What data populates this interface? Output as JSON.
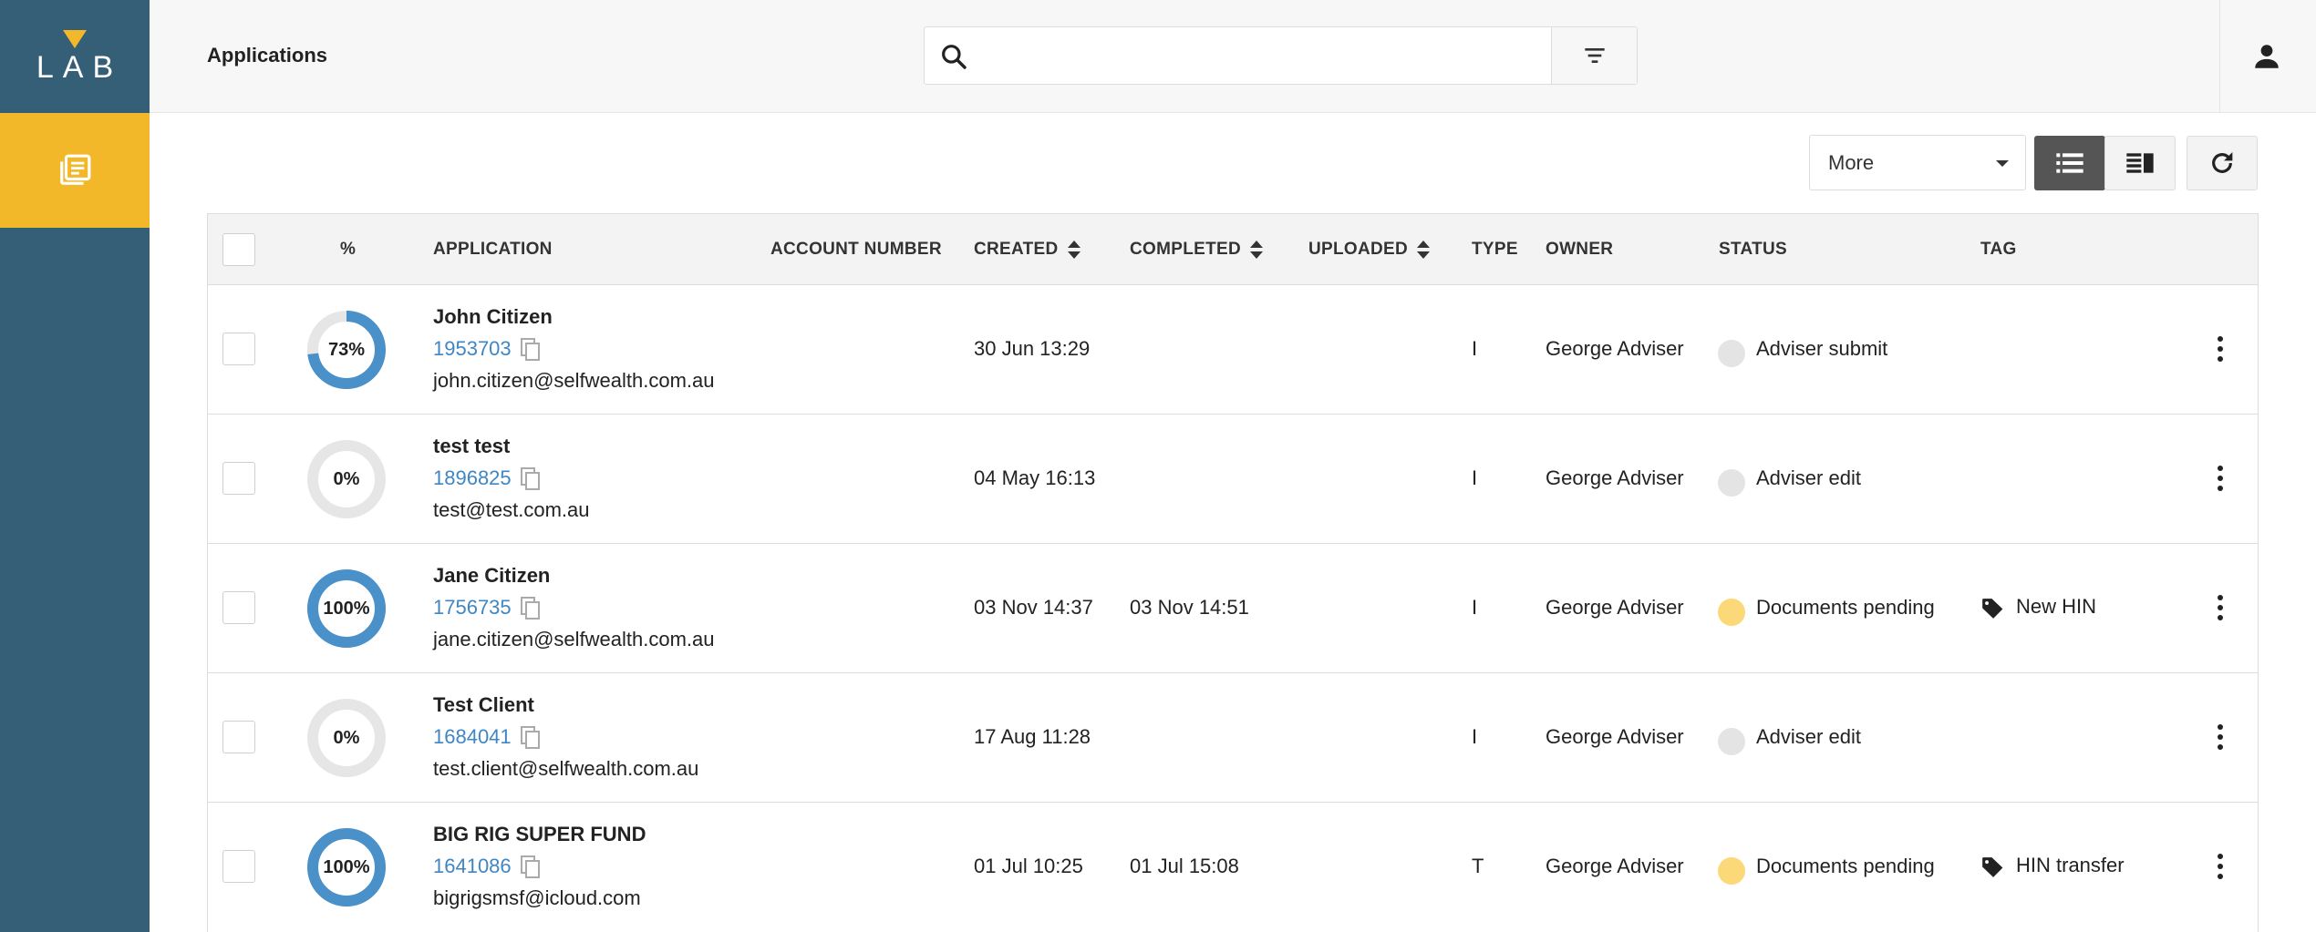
{
  "app": {
    "logo_text": "LAB",
    "page_title": "Applications"
  },
  "sidebar": {
    "items": [
      {
        "icon": "applications-icon",
        "active": true
      }
    ]
  },
  "search": {
    "value": "",
    "placeholder": ""
  },
  "toolbar": {
    "more_label": "More",
    "views": [
      "list",
      "split"
    ],
    "active_view": "list"
  },
  "table": {
    "headers": {
      "percent": "%",
      "application": "APPLICATION",
      "account_number": "ACCOUNT NUMBER",
      "created": "CREATED",
      "completed": "COMPLETED",
      "uploaded": "UPLOADED",
      "type": "TYPE",
      "owner": "OWNER",
      "status": "STATUS",
      "tag": "TAG"
    },
    "rows": [
      {
        "percent": 73,
        "percent_label": "73%",
        "name": "John Citizen",
        "app_no": "1953703",
        "email": "john.citizen@selfwealth.com.au",
        "account_number": "",
        "created": "30 Jun 13:29",
        "completed": "",
        "uploaded": "",
        "type": "I",
        "owner": "George Adviser",
        "status": "Adviser submit",
        "status_color": "#e4e4e4",
        "tag": ""
      },
      {
        "percent": 0,
        "percent_label": "0%",
        "name": "test test",
        "app_no": "1896825",
        "email": "test@test.com.au",
        "account_number": "",
        "created": "04 May 16:13",
        "completed": "",
        "uploaded": "",
        "type": "I",
        "owner": "George Adviser",
        "status": "Adviser edit",
        "status_color": "#e4e4e4",
        "tag": ""
      },
      {
        "percent": 100,
        "percent_label": "100%",
        "name": "Jane Citizen",
        "app_no": "1756735",
        "email": "jane.citizen@selfwealth.com.au",
        "account_number": "",
        "created": "03 Nov 14:37",
        "completed": "03 Nov 14:51",
        "uploaded": "",
        "type": "I",
        "owner": "George Adviser",
        "status": "Documents pending",
        "status_color": "#fbd978",
        "tag": "New HIN"
      },
      {
        "percent": 0,
        "percent_label": "0%",
        "name": "Test Client",
        "app_no": "1684041",
        "email": "test.client@selfwealth.com.au",
        "account_number": "",
        "created": "17 Aug 11:28",
        "completed": "",
        "uploaded": "",
        "type": "I",
        "owner": "George Adviser",
        "status": "Adviser edit",
        "status_color": "#e4e4e4",
        "tag": ""
      },
      {
        "percent": 100,
        "percent_label": "100%",
        "name": "BIG RIG SUPER FUND",
        "app_no": "1641086",
        "email": "bigrigsmsf@icloud.com",
        "account_number": "",
        "created": "01 Jul 10:25",
        "completed": "01 Jul 15:08",
        "uploaded": "",
        "type": "T",
        "owner": "George Adviser",
        "status": "Documents pending",
        "status_color": "#fbd978",
        "tag": "HIN transfer"
      }
    ]
  },
  "colors": {
    "sidebar": "#355f77",
    "accent": "#f2b829",
    "progress": "#4a90c9",
    "progress_track": "#e6e6e6",
    "link": "#3f86c4"
  }
}
